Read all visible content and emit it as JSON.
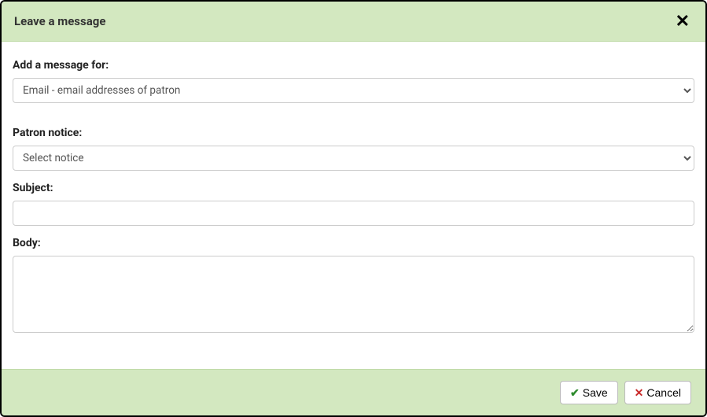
{
  "header": {
    "title": "Leave a message"
  },
  "fields": {
    "add_message": {
      "label": "Add a message for:",
      "selected": "Email - email addresses of patron"
    },
    "patron_notice": {
      "label": "Patron notice:",
      "selected": "Select notice"
    },
    "subject": {
      "label": "Subject:",
      "value": ""
    },
    "body": {
      "label": "Body:",
      "value": ""
    }
  },
  "footer": {
    "save_label": "Save",
    "cancel_label": "Cancel"
  }
}
